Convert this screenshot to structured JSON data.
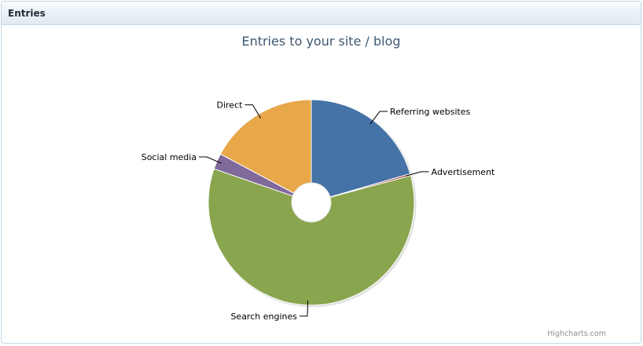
{
  "panel": {
    "title": "Entries"
  },
  "chart_data": {
    "type": "pie",
    "title": "Entries to your site / blog",
    "slices": [
      {
        "label": "Referring websites",
        "value": 20.5,
        "color": "#4572a7"
      },
      {
        "label": "Advertisement",
        "value": 0.3,
        "color": "#aa4643"
      },
      {
        "label": "Search engines",
        "value": 59.5,
        "color": "#89a54e"
      },
      {
        "label": "Social media",
        "value": 2.5,
        "color": "#80699b"
      },
      {
        "label": "Direct",
        "value": 17.2,
        "color": "#e8a749"
      }
    ],
    "inner_hole": true,
    "legend": false,
    "credits": "Highcharts.com"
  }
}
